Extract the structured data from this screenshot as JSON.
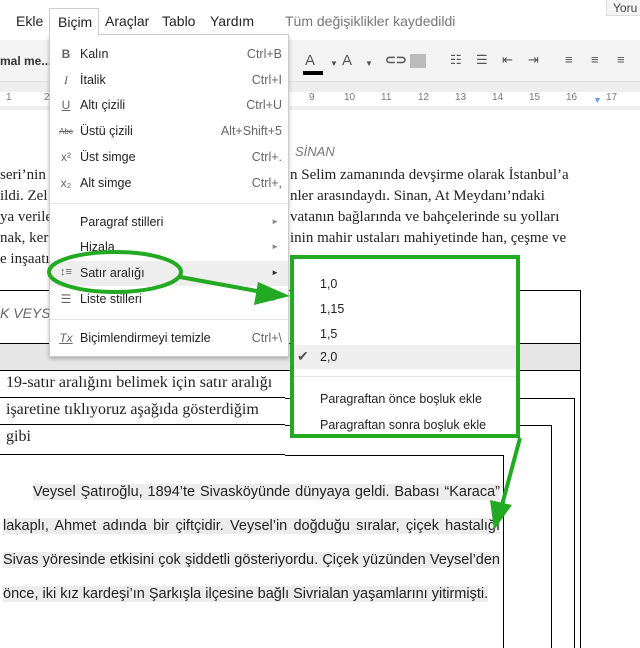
{
  "menubar": {
    "items": [
      "Ekle",
      "Biçim",
      "Araçlar",
      "Tablo",
      "Yardım"
    ],
    "save_status": "Tüm değişiklikler kaydedildi",
    "share_label": "Yoru"
  },
  "toolbar": {
    "style_select": "mal me...",
    "text_color": "#000000"
  },
  "ruler": {
    "ticks": [
      "1",
      "2",
      "9",
      "10",
      "11",
      "12",
      "13",
      "14",
      "15",
      "16",
      "17"
    ]
  },
  "format_menu": {
    "items": [
      {
        "icon": "bold-icon",
        "glyph": "B",
        "label": "Kalın",
        "shortcut": "Ctrl+B"
      },
      {
        "icon": "italic-icon",
        "glyph": "I",
        "label": "İtalik",
        "shortcut": "Ctrl+I"
      },
      {
        "icon": "underline-icon",
        "glyph": "U",
        "label": "Altı çizili",
        "shortcut": "Ctrl+U"
      },
      {
        "icon": "strikethrough-icon",
        "glyph": "Abc",
        "label": "Üstü çizili",
        "shortcut": "Alt+Shift+5"
      },
      {
        "icon": "superscript-icon",
        "glyph": "x²",
        "label": "Üst simge",
        "shortcut": "Ctrl+."
      },
      {
        "icon": "subscript-icon",
        "glyph": "x₂",
        "label": "Alt simge",
        "shortcut": "Ctrl+,"
      },
      {
        "label": "Paragraf stilleri",
        "submenu": true
      },
      {
        "label": "Hizala",
        "submenu": true
      },
      {
        "icon": "line-spacing-icon",
        "glyph": "↕≡",
        "label": "Satır aralığı",
        "submenu": true,
        "highlighted": true
      },
      {
        "icon": "list-styles-icon",
        "glyph": "☰",
        "label": "Liste stilleri",
        "submenu": true
      },
      {
        "icon": "clear-formatting-icon",
        "glyph": "Tx",
        "label": "Biçimlendirmeyi temizle",
        "shortcut": "Ctrl+\\"
      }
    ]
  },
  "line_spacing_menu": {
    "items": [
      "1,0",
      "1,15",
      "1,5",
      "2,0"
    ],
    "selected": "2,0",
    "extra": [
      "Paragraftan önce boşluk ekle",
      "Paragraftan sonra boşluk ekle"
    ]
  },
  "annotation_color": "#22aa22",
  "document": {
    "heading_fragment": "SİNAN",
    "left_fragments": [
      "seri’nin",
      "ildi. Zel",
      "ya verile",
      "nak, ker",
      "e inşaatı"
    ],
    "right_fragments": [
      "n Selim zamanında devşirme olarak İstanbul’a",
      "nler arasındaydı. Sinan, At Meydanı’ndaki",
      "vatanın bağlarında ve bahçelerinde su yolları",
      "inin mahir ustaları mahiyetinde han, çeşme ve"
    ],
    "table_heading_fragment": "K VEYSİ",
    "note_lines": [
      "19-satır aralığını belimek için satır aralığı",
      "işaretine tıklıyoruz aşağıda gösterdiğim",
      "gibi"
    ],
    "paragraph": "Veysel Şatıroğlu, 1894’te Sivasköyünde dünyaya geldi. Babası “Karaca” lakaplı, Ahmet adında bir çiftçidir. Veysel’in doğduğu sıralar, çiçek hastalığı Sivas yöresinde etkisini çok şiddetli gösteriyordu. Çiçek yüzünden Veysel’den önce, iki kız kardeşi’ın Şarkışla ilçesine bağlı Sivrialan yaşamlarını yitirmişti."
  }
}
